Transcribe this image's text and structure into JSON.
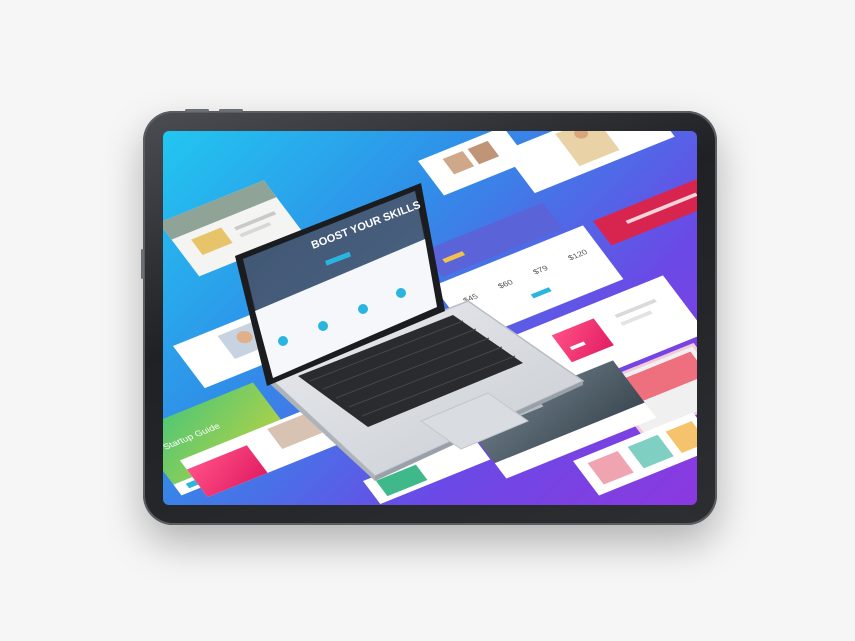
{
  "laptop": {
    "headline": "BOOST YOUR SKILLS"
  },
  "tiles": {
    "prices": [
      "$45",
      "$60",
      "$79",
      "$120"
    ]
  },
  "colors": {
    "screen_start": "#22c6f0",
    "screen_end": "#8b39df",
    "tablet_frame": "#2a2c2f",
    "accent_pink": "#ff3f7a"
  }
}
